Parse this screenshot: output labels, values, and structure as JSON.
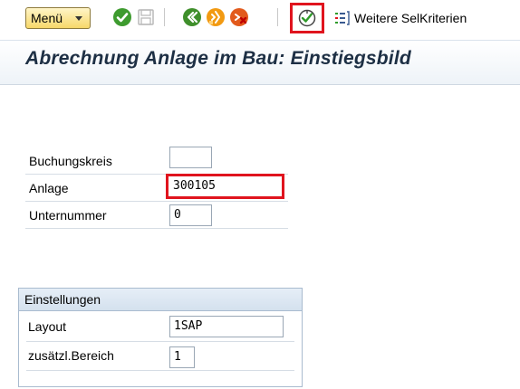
{
  "toolbar": {
    "menu_label": "Menü",
    "icons": [
      "checkmark-icon",
      "save-icon",
      "back-icon",
      "exit-icon",
      "cancel-icon",
      "execute-icon",
      "selection-criteria-icon"
    ],
    "selcrit_label": "Weitere SelKriterien"
  },
  "title": "Abrechnung Anlage im Bau: Einstiegsbild",
  "form": {
    "company_code": {
      "label": "Buchungskreis",
      "value": ""
    },
    "asset": {
      "label": "Anlage",
      "value": "300105"
    },
    "sub_number": {
      "label": "Unternummer",
      "value": "0"
    }
  },
  "settings": {
    "title": "Einstellungen",
    "layout": {
      "label": "Layout",
      "value": "1SAP"
    },
    "extra_area": {
      "label": "zusätzl.Bereich",
      "value": "1"
    }
  },
  "colors": {
    "highlight": "#e0141e",
    "title_text": "#1d2f44",
    "menu_bg": "#f7d86a"
  }
}
